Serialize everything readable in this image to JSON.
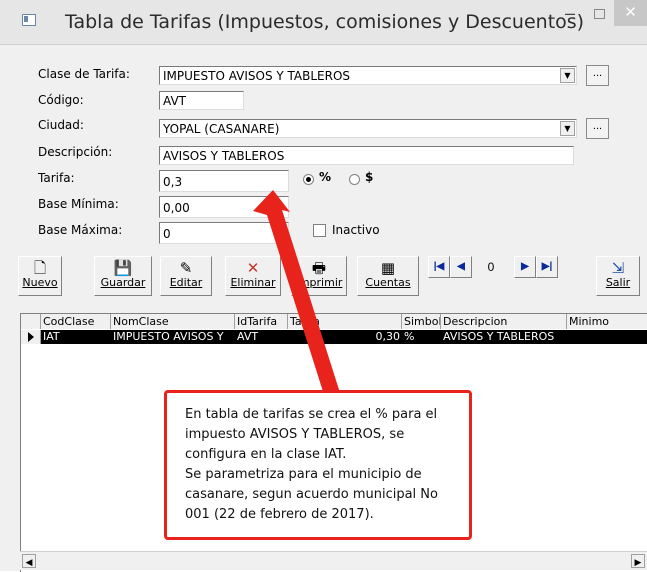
{
  "window": {
    "title": "Tabla de Tarifas (Impuestos, comisiones y Descuentos)",
    "min": "–",
    "close": "✕"
  },
  "form": {
    "clase_label": "Clase de Tarifa:",
    "clase_value": "IMPUESTO AVISOS Y TABLEROS",
    "codigo_label": "Código:",
    "codigo_value": "AVT",
    "ciudad_label": "Ciudad:",
    "ciudad_value": "YOPAL  (CASANARE)",
    "descripcion_label": "Descripción:",
    "descripcion_value": "AVISOS Y TABLEROS",
    "tarifa_label": "Tarifa:",
    "tarifa_value": "0,3",
    "radio_percent_label": "%",
    "radio_dollar_label": "$",
    "base_min_label": "Base Mínima:",
    "base_min_value": "0,00",
    "base_max_label": "Base Máxima:",
    "base_max_value": "0",
    "inactivo_label": "Inactivo",
    "dots_label": "..."
  },
  "toolbar": {
    "nuevo": "Nuevo",
    "guardar": "Guardar",
    "editar": "Editar",
    "eliminar": "Eliminar",
    "imprimir": "Imprimir",
    "cuentas": "Cuentas",
    "record": "0",
    "salir": "Salir"
  },
  "grid": {
    "headers": [
      "CodClase",
      "NomClase",
      "IdTarifa",
      "Tarifa",
      "Simbol",
      "Descripcion",
      "Minimo"
    ],
    "rows": [
      [
        "IAT",
        "IMPUESTO AVISOS Y",
        "AVT",
        "0,30",
        "%",
        "AVISOS Y TABLEROS",
        ""
      ]
    ]
  },
  "callout": {
    "line1": "En tabla de tarifas se crea el % para el",
    "line2": "impuesto AVISOS Y TABLEROS, se",
    "line3": "configura en la clase IAT.",
    "line4": "Se parametriza para el municipio de",
    "line5": "casanare, segun acuerdo municipal No",
    "line6": "001 (22 de febrero de 2017)."
  },
  "colors": {
    "annotation_red": "#e8231c",
    "selected_row": "#000000"
  }
}
